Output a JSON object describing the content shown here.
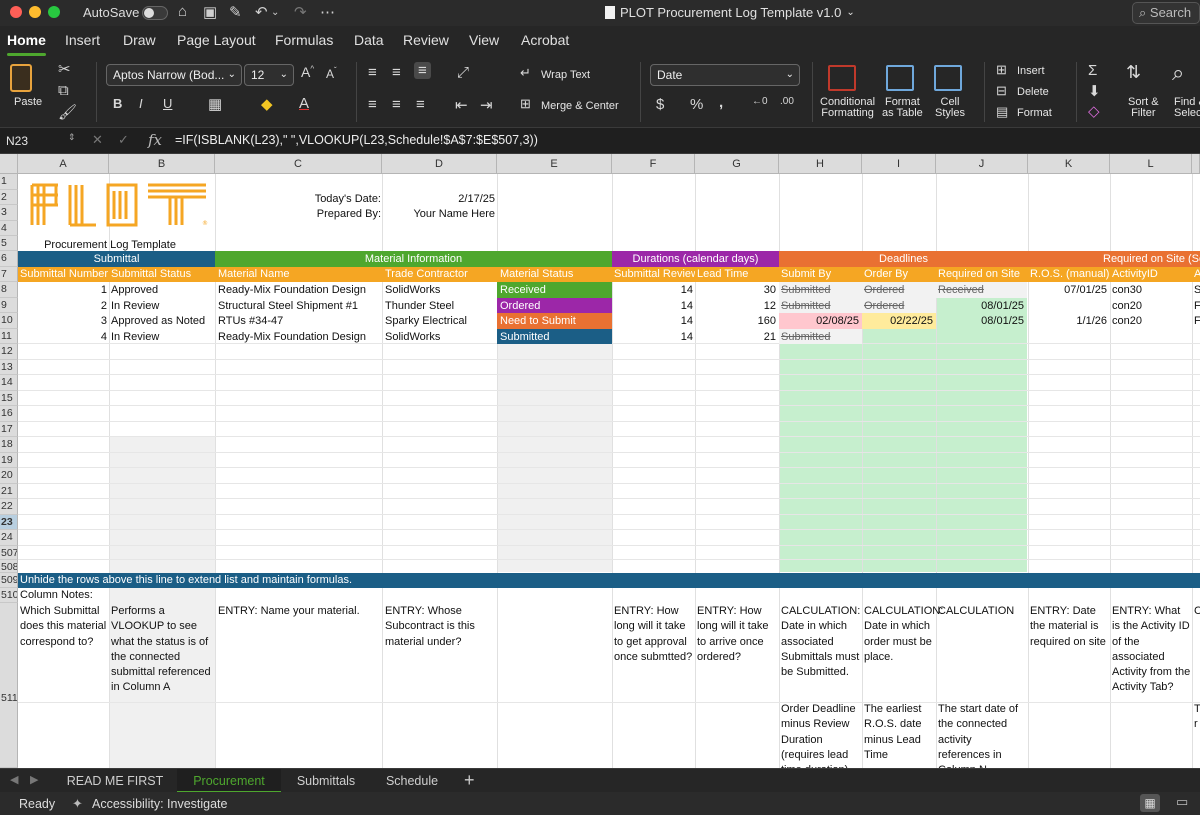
{
  "titlebar": {
    "autosave_label": "AutoSave",
    "doc_title": "PLOT Procurement Log Template v1.0",
    "search_placeholder": "Search"
  },
  "ribbon_tabs": [
    "Home",
    "Insert",
    "Draw",
    "Page Layout",
    "Formulas",
    "Data",
    "Review",
    "View",
    "Acrobat"
  ],
  "ribbon": {
    "paste_label": "Paste",
    "font_name": "Aptos Narrow (Bod...",
    "font_size": "12",
    "wrap_text": "Wrap Text",
    "merge_center": "Merge & Center",
    "number_format": "Date",
    "conditional_formatting": [
      "Conditional",
      "Formatting"
    ],
    "format_as_table": [
      "Format",
      "as Table"
    ],
    "cell_styles": [
      "Cell",
      "Styles"
    ],
    "insert": "Insert",
    "delete": "Delete",
    "format": "Format",
    "sort_filter": [
      "Sort &",
      "Filter"
    ],
    "find_select": [
      "Find &",
      "Select"
    ]
  },
  "formula_bar": {
    "name_box": "N23",
    "formula": "=IF(ISBLANK(L23),\" \",VLOOKUP(L23,Schedule!$A$7:$E$507,3))"
  },
  "columns": [
    "A",
    "B",
    "C",
    "D",
    "E",
    "F",
    "G",
    "H",
    "I",
    "J",
    "K",
    "L"
  ],
  "rows": [
    "1",
    "2",
    "3",
    "4",
    "5",
    "6",
    "7",
    "8",
    "9",
    "10",
    "11",
    "12",
    "13",
    "14",
    "15",
    "16",
    "17",
    "18",
    "19",
    "20",
    "21",
    "22",
    "23",
    "24",
    "507",
    "508",
    "509",
    "510",
    "511"
  ],
  "sheet": {
    "logo_text": "PLOT",
    "template_title": "Procurement Log Template",
    "todays_date_label": "Today's Date:",
    "todays_date": "2/17/25",
    "prepared_by_label": "Prepared By:",
    "prepared_by": "Your Name Here",
    "groups": {
      "submittal": "Submittal",
      "material_info": "Material Information",
      "durations": "Durations (calendar days)",
      "deadlines": "Deadlines",
      "required_on_site": "Required on Site (Sch"
    },
    "headers": [
      "Submittal Number",
      "Submittal Status",
      "Material Name",
      "Trade Contractor",
      "Material Status",
      "Submittal Review",
      "Lead Time",
      "Submit By",
      "Order By",
      "Required on Site",
      "R.O.S. (manual)",
      "ActivityID",
      "A"
    ],
    "data_rows": [
      {
        "num": "1",
        "status": "Approved",
        "material": "Ready-Mix Foundation Design",
        "trade": "SolidWorks",
        "mat_status": "Received",
        "review": "14",
        "lead": "30",
        "submit_by": "Submitted",
        "order_by": "Ordered",
        "ros": "Received",
        "ros_manual": "07/01/25",
        "activity": "con30",
        "extra": "S"
      },
      {
        "num": "2",
        "status": "In Review",
        "material": "Structural Steel Shipment #1",
        "trade": "Thunder Steel",
        "mat_status": "Ordered",
        "review": "14",
        "lead": "12",
        "submit_by": "Submitted",
        "order_by": "Ordered",
        "ros": "08/01/25",
        "ros_manual": "",
        "activity": "con20",
        "extra": "F"
      },
      {
        "num": "3",
        "status": "Approved as Noted",
        "material": "RTUs #34-47",
        "trade": "Sparky Electrical",
        "mat_status": "Need to Submit",
        "review": "14",
        "lead": "160",
        "submit_by": "02/08/25",
        "order_by": "02/22/25",
        "ros": "08/01/25",
        "ros_manual": "1/1/26",
        "activity": "con20",
        "extra": "F"
      },
      {
        "num": "4",
        "status": "In Review",
        "material": "Ready-Mix Foundation Design",
        "trade": "SolidWorks",
        "mat_status": "Submitted",
        "review": "14",
        "lead": "21",
        "submit_by": "Submitted",
        "order_by": "",
        "ros": "",
        "ros_manual": "",
        "activity": "",
        "extra": ""
      }
    ],
    "unhide_note": "Unhide the rows above this line to extend list and maintain formulas.",
    "column_notes_label": "Column Notes:",
    "notes": {
      "a": "Which Submittal does this material correspond to?",
      "b": "Performs a VLOOKUP to see what the status is of the connected submittal referenced in Column A",
      "c": "ENTRY: Name your material.",
      "d": "ENTRY: Whose Subcontract is this material under?",
      "f": "ENTRY: How long will it take to get approval once submtted?",
      "g": "ENTRY: How long will it take to arrive once ordered?",
      "h": "CALCULATION: Date in which associated Submittals must be Submitted.",
      "i": "CALCULATION: Date in which order must be place.",
      "j": "CALCULATION",
      "k": "ENTRY: Date the material is required on site",
      "l": "ENTRY: What is the Activity ID of the associated Activity from the Activity Tab?",
      "m": "C",
      "h2": "Order Deadline minus Review Duration (requires lead time duration)",
      "i2": "The earliest R.O.S. date minus Lead Time",
      "j2": "The start date of the connected activity references in Column N",
      "m2": "T r"
    }
  },
  "sheet_tabs": [
    "READ ME FIRST",
    "Procurement",
    "Submittals",
    "Schedule"
  ],
  "status": {
    "ready": "Ready",
    "accessibility": "Accessibility: Investigate"
  },
  "colors": {
    "submittal_blue": "#1b5e86",
    "material_green": "#4ea72e",
    "durations_purple": "#9c27a8",
    "deadlines_orange": "#e97132",
    "header_orange": "#f5a623",
    "received_green": "#4ea72e",
    "ordered_purple": "#9c27a8",
    "need_submit_orange": "#e97132",
    "submitted_blue": "#1b5e86",
    "light_green": "#c6efce",
    "light_red": "#ffc7ce",
    "light_yellow": "#ffeb9c",
    "grey_column": "#f0f0f0"
  }
}
